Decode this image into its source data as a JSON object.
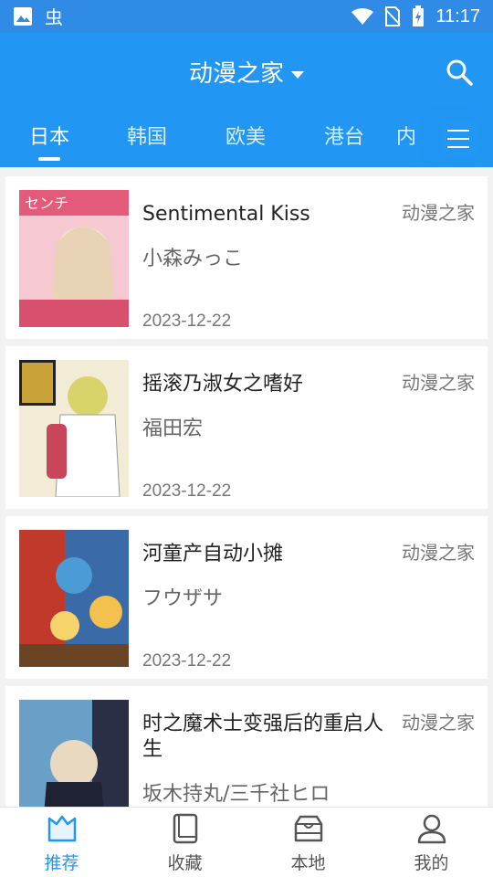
{
  "status": {
    "time": "11:17"
  },
  "header": {
    "title": "动漫之家"
  },
  "tabs": [
    {
      "label": "日本",
      "active": true
    },
    {
      "label": "韩国"
    },
    {
      "label": "欧美"
    },
    {
      "label": "港台"
    },
    {
      "label": "内"
    }
  ],
  "comics": [
    {
      "title": "Sentimental Kiss",
      "author": "小森みっこ",
      "date": "2023-12-22",
      "source": "动漫之家",
      "cover_colors": [
        "#e35a7a",
        "#f6c8d2"
      ]
    },
    {
      "title": "摇滚乃淑女之嗜好",
      "author": "福田宏",
      "date": "2023-12-22",
      "source": "动漫之家",
      "cover_colors": [
        "#c9a23a",
        "#f2ecd6"
      ]
    },
    {
      "title": "河童产自动小摊",
      "author": "フウザサ",
      "date": "2023-12-22",
      "source": "动漫之家",
      "cover_colors": [
        "#c0392b",
        "#3a6aa8"
      ]
    },
    {
      "title": "时之魔术士变强后的重启人生",
      "author": "坂木持丸/三千社ヒロ",
      "date": "",
      "source": "动漫之家",
      "cover_colors": [
        "#2b2f46",
        "#6aa0c8"
      ]
    }
  ],
  "nav": [
    {
      "label": "推荐",
      "icon": "recommend-icon",
      "active": true
    },
    {
      "label": "收藏",
      "icon": "book-icon"
    },
    {
      "label": "本地",
      "icon": "box-icon"
    },
    {
      "label": "我的",
      "icon": "person-icon"
    }
  ],
  "colors": {
    "primary": "#2196f3",
    "statusbar": "#2f8be6"
  }
}
